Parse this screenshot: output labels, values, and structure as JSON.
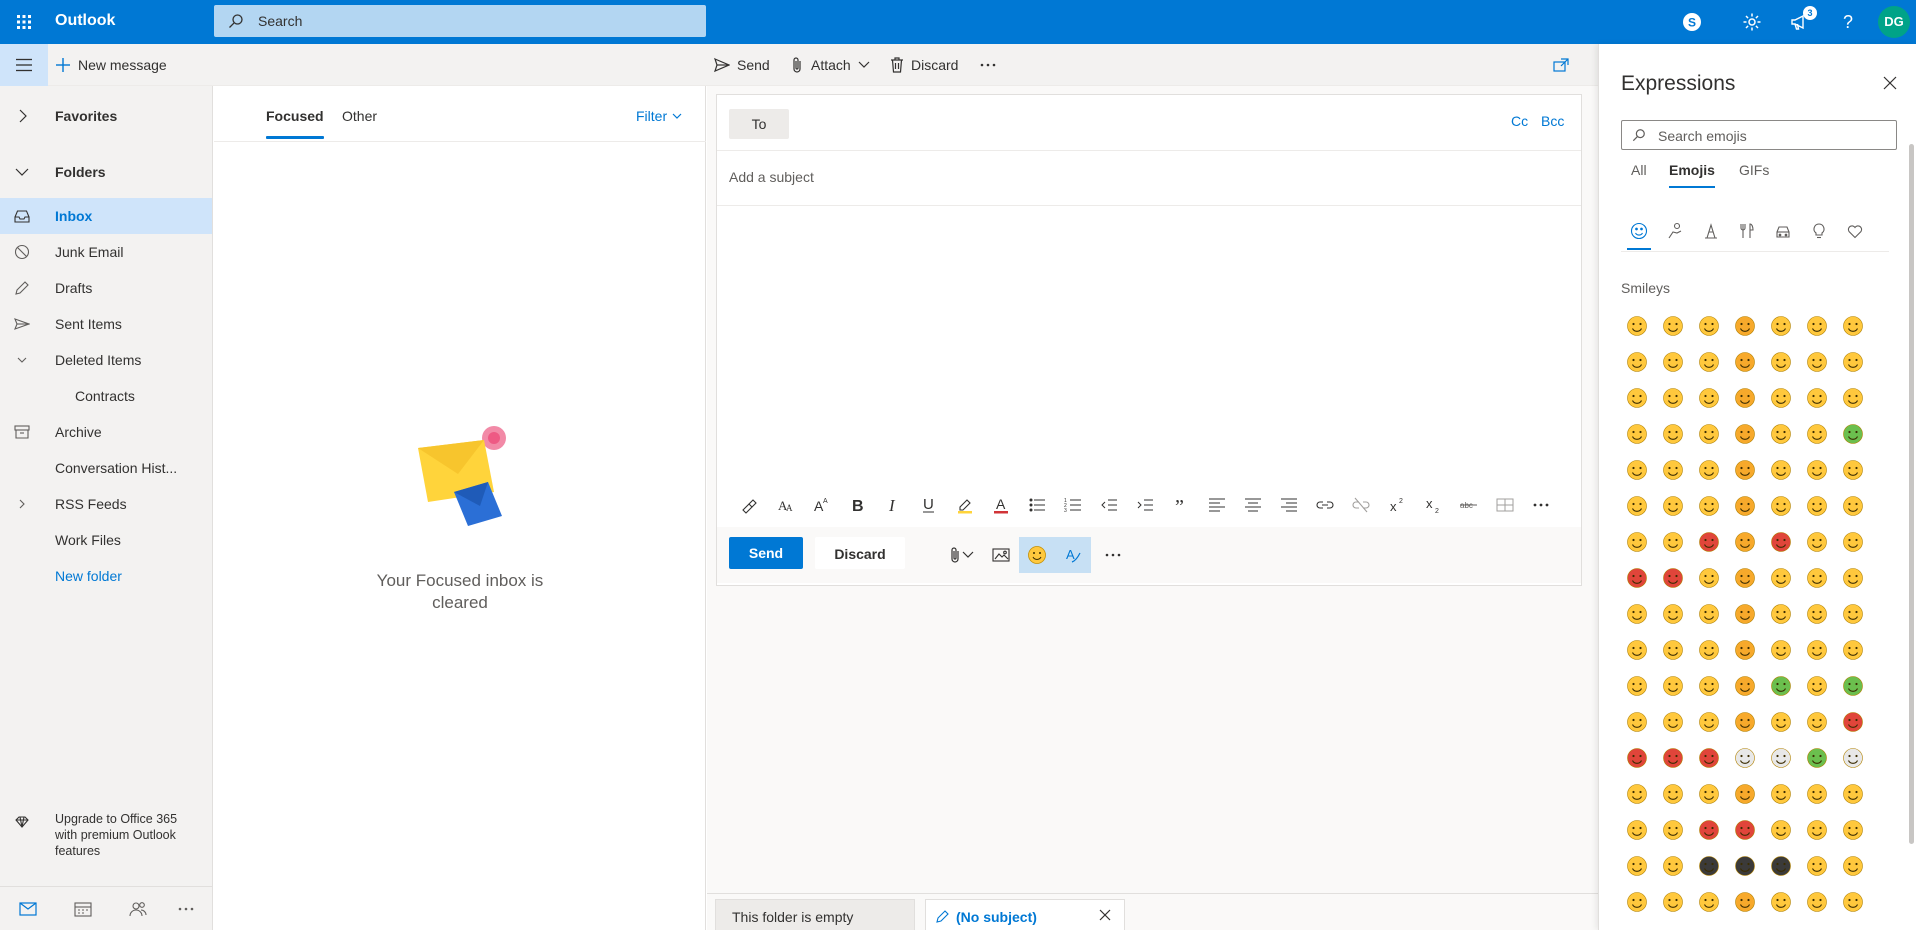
{
  "app": {
    "brand": "Outlook"
  },
  "search": {
    "placeholder": "Search"
  },
  "topbar": {
    "notifications_count": "3",
    "avatar_initials": "DG"
  },
  "command_bar": {
    "new_message": "New message",
    "send": "Send",
    "attach": "Attach",
    "discard": "Discard"
  },
  "nav": {
    "favorites": "Favorites",
    "folders": "Folders",
    "items": [
      {
        "label": "Inbox",
        "icon": "inbox-icon",
        "selected": true
      },
      {
        "label": "Junk Email",
        "icon": "block-icon"
      },
      {
        "label": "Drafts",
        "icon": "pencil-icon"
      },
      {
        "label": "Sent Items",
        "icon": "send-icon"
      },
      {
        "label": "Deleted Items",
        "icon": "chevron-down-icon"
      },
      {
        "label": "Contracts",
        "icon": ""
      },
      {
        "label": "Archive",
        "icon": "archive-icon"
      },
      {
        "label": "Conversation Hist...",
        "icon": ""
      },
      {
        "label": "RSS Feeds",
        "icon": "chevron-right-icon"
      },
      {
        "label": "Work Files",
        "icon": ""
      },
      {
        "label": "New folder",
        "icon": ""
      }
    ],
    "upgrade": "Upgrade to Office 365 with premium Outlook features"
  },
  "message_list": {
    "tabs": [
      "Focused",
      "Other"
    ],
    "filter": "Filter",
    "empty_text": "Your Focused inbox is cleared"
  },
  "compose": {
    "to_label": "To",
    "cc": "Cc",
    "bcc": "Bcc",
    "subject_placeholder": "Add a subject",
    "send": "Send",
    "discard": "Discard"
  },
  "bottom_tabs": {
    "folder_empty": "This folder is empty",
    "draft": "(No subject)"
  },
  "expressions": {
    "title": "Expressions",
    "search_placeholder": "Search emojis",
    "tabs": [
      "All",
      "Emojis",
      "GIFs"
    ],
    "active_tab": "Emojis",
    "section": "Smileys",
    "emojis": [
      "😁",
      "😁",
      "😁",
      "😂",
      "🤣",
      "😃",
      "😄",
      "😅",
      "😆",
      "😇",
      "😉",
      "😊",
      "🙂",
      "🙃",
      "☺",
      "😋",
      "😌",
      "😍",
      "😘",
      "😗",
      "😙",
      "😚",
      "😜",
      "😝",
      "😛",
      "🤑",
      "😝",
      "🤢",
      "🤓",
      "😎",
      "😬",
      "🤡",
      "🤠",
      "🤗",
      "😏",
      "😶",
      "😐",
      "😑",
      "😒",
      "🙄",
      "🤔",
      "🤥",
      "😳",
      "😞",
      "😡",
      "😤",
      "😠",
      "😔",
      "😟",
      "😠",
      "😡",
      "😔",
      "😕",
      "🙁",
      "☹",
      "😣",
      "😫",
      "😩",
      "😤",
      "😮",
      "😱",
      "😨",
      "😰",
      "😯",
      "😦",
      "😧",
      "😢",
      "😥",
      "😪",
      "😓",
      "😭",
      "😵",
      "😲",
      "🤐",
      "🤢",
      "🤧",
      "🤮",
      "😷",
      "🤒",
      "🤕",
      "😴",
      "💤",
      "💩",
      "😈",
      "👿",
      "👹",
      "👺",
      "💀",
      "👻",
      "👽",
      "🤖",
      "😺",
      "😸",
      "😹",
      "😻",
      "😼",
      "😽",
      "🙀",
      "😿",
      "😾",
      "👄",
      "👅",
      "👂",
      "👃",
      "👁",
      "👀",
      "🧠",
      "👤",
      "👥",
      "🗣",
      "👫",
      "👭",
      "👬",
      "👪",
      "👨‍👩‍👧",
      "👨‍👩‍👦",
      "💑",
      "💏",
      "👨‍👩‍👧‍👦"
    ]
  },
  "colors": {
    "brand_blue": "#0078d4",
    "selected_bg": "#cfe4fa",
    "avatar_bg": "#00a388"
  }
}
